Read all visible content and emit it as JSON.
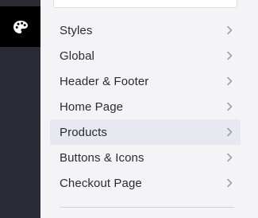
{
  "sidebar": {
    "tool_icon": "palette-icon"
  },
  "menu": {
    "items": [
      {
        "label": "Styles",
        "icon": "chevron-right-icon",
        "active": false
      },
      {
        "label": "Global",
        "icon": "chevron-right-icon",
        "active": false
      },
      {
        "label": "Header & Footer",
        "icon": "chevron-right-icon",
        "active": false
      },
      {
        "label": "Home Page",
        "icon": "chevron-right-icon",
        "active": false
      },
      {
        "label": "Products",
        "icon": "chevron-right-icon",
        "active": true
      },
      {
        "label": "Buttons & Icons",
        "icon": "chevron-right-icon",
        "active": false
      },
      {
        "label": "Checkout Page",
        "icon": "chevron-right-icon",
        "active": false
      }
    ]
  },
  "colors": {
    "sidebar_bg": "#2b2b35",
    "active_tool_bg": "#000000",
    "panel_bg": "#f4f4f6",
    "active_item_bg": "#e8e8f1",
    "text": "#2b2b35",
    "chevron": "#a0a0a8"
  }
}
